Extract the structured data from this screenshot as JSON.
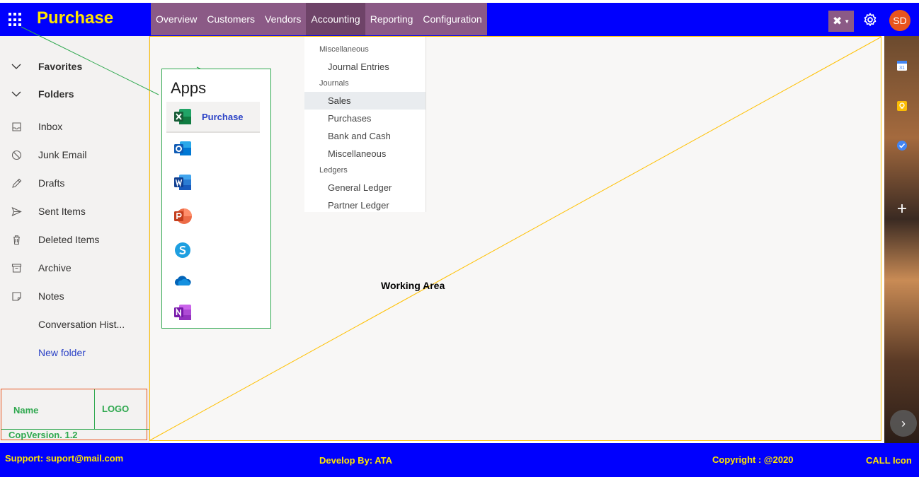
{
  "app": {
    "title": "Purchase"
  },
  "nav": {
    "items": [
      {
        "label": "Overview"
      },
      {
        "label": "Customers"
      },
      {
        "label": "Vendors"
      },
      {
        "label": "Accounting"
      },
      {
        "label": "Reporting"
      },
      {
        "label": "Configuration"
      }
    ],
    "active": "Accounting"
  },
  "header": {
    "tools_icon": "tools-icon",
    "settings_icon": "gear-icon",
    "avatar_initials": "SD",
    "avatar_color": "#e8541d"
  },
  "sidebar": {
    "items": [
      {
        "label": "Favorites",
        "icon": "chevron-down-icon"
      },
      {
        "label": "Folders",
        "icon": "chevron-down-icon"
      },
      {
        "label": "Inbox",
        "icon": "inbox-icon"
      },
      {
        "label": "Junk Email",
        "icon": "block-icon"
      },
      {
        "label": "Drafts",
        "icon": "pencil-icon"
      },
      {
        "label": "Sent Items",
        "icon": "send-icon"
      },
      {
        "label": "Deleted Items",
        "icon": "trash-icon"
      },
      {
        "label": "Archive",
        "icon": "archive-icon"
      },
      {
        "label": "Notes",
        "icon": "note-icon"
      },
      {
        "label": "Conversation Hist..."
      },
      {
        "label": "New folder"
      }
    ],
    "name_label": "Name",
    "logo_label": "LOGO",
    "version_label": "CopVersion. 1.2"
  },
  "apps": {
    "title": "Apps",
    "items": [
      {
        "name": "Purchase",
        "icon": "excel-icon"
      },
      {
        "icon": "outlook-icon"
      },
      {
        "icon": "word-icon"
      },
      {
        "icon": "powerpoint-icon"
      },
      {
        "icon": "skype-icon"
      },
      {
        "icon": "onedrive-icon"
      },
      {
        "icon": "onenote-icon"
      }
    ]
  },
  "dropdown": {
    "sections": [
      {
        "header": "Miscellaneous",
        "items": [
          "Journal Entries"
        ]
      },
      {
        "header": "Journals",
        "items": [
          "Sales",
          "Purchases",
          "Bank and Cash",
          "Miscellaneous"
        ]
      },
      {
        "header": "Ledgers",
        "items": [
          "General Ledger",
          "Partner Ledger"
        ]
      }
    ],
    "highlighted": "Sales"
  },
  "workarea": {
    "label": "Working Area"
  },
  "rightrail": {
    "icons": [
      "calendar-icon",
      "keep-icon",
      "tasks-icon",
      "plus-icon"
    ],
    "calendar_day": "31",
    "next_icon": "chevron-right-icon"
  },
  "footer": {
    "support": "Support:  suport@mail.com",
    "developer": "Develop By:  ATA",
    "copyright": "Copyright : @2020",
    "call": "CALL Icon"
  },
  "colors": {
    "brand_blue": "#0000fe",
    "nav_purple": "#8b5a86",
    "title_yellow": "#ffe600",
    "green_outline": "#2fa84f",
    "work_border": "#ffc000"
  }
}
